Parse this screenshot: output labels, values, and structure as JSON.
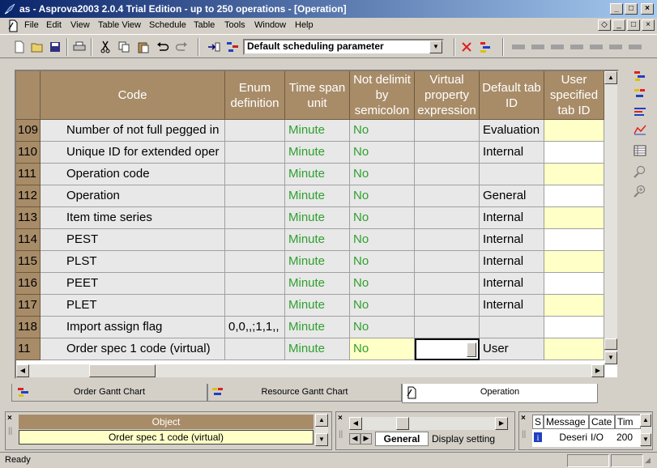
{
  "window": {
    "title": "as - Asprova2003 2.0.4 Trial Edition  - up to 250 operations - [Operation]"
  },
  "menu": [
    "File",
    "Edit",
    "View",
    "Table View",
    "Schedule",
    "Table",
    "Tools",
    "Window",
    "Help"
  ],
  "toolbar": {
    "schedule_param": "Default scheduling parameter"
  },
  "grid": {
    "columns": [
      "Code",
      "Enum definition",
      "Time span unit",
      "Not delimit by semicolon",
      "Virtual property expression",
      "Default tab ID",
      "User specified tab ID"
    ],
    "rows": [
      {
        "no": "109",
        "code": "Number of not full pegged in",
        "enum": "",
        "unit": "Minute",
        "nodelim": "No",
        "virtual": "",
        "tab": "Evaluation",
        "usertab": "",
        "usercolor": "yel"
      },
      {
        "no": "110",
        "code": "Unique ID for extended oper",
        "enum": "",
        "unit": "Minute",
        "nodelim": "No",
        "virtual": "",
        "tab": "Internal",
        "usertab": "",
        "usercolor": "wht"
      },
      {
        "no": "111",
        "code": "Operation code",
        "enum": "",
        "unit": "Minute",
        "nodelim": "No",
        "virtual": "",
        "tab": "",
        "usertab": "",
        "usercolor": "yel"
      },
      {
        "no": "112",
        "code": "Operation",
        "enum": "",
        "unit": "Minute",
        "nodelim": "No",
        "virtual": "",
        "tab": "General",
        "usertab": "",
        "usercolor": "wht"
      },
      {
        "no": "113",
        "code": "Item time series",
        "enum": "",
        "unit": "Minute",
        "nodelim": "No",
        "virtual": "",
        "tab": "Internal",
        "usertab": "",
        "usercolor": "yel"
      },
      {
        "no": "114",
        "code": "PEST",
        "enum": "",
        "unit": "Minute",
        "nodelim": "No",
        "virtual": "",
        "tab": "Internal",
        "usertab": "",
        "usercolor": "wht"
      },
      {
        "no": "115",
        "code": "PLST",
        "enum": "",
        "unit": "Minute",
        "nodelim": "No",
        "virtual": "",
        "tab": "Internal",
        "usertab": "",
        "usercolor": "yel"
      },
      {
        "no": "116",
        "code": "PEET",
        "enum": "",
        "unit": "Minute",
        "nodelim": "No",
        "virtual": "",
        "tab": "Internal",
        "usertab": "",
        "usercolor": "wht"
      },
      {
        "no": "117",
        "code": "PLET",
        "enum": "",
        "unit": "Minute",
        "nodelim": "No",
        "virtual": "",
        "tab": "Internal",
        "usertab": "",
        "usercolor": "yel"
      },
      {
        "no": "118",
        "code": "Import assign flag",
        "enum": "0,0,,;1,1,,",
        "unit": "Minute",
        "nodelim": "No",
        "virtual": "",
        "tab": "",
        "usertab": "",
        "usercolor": "wht"
      },
      {
        "no": "11",
        "code": "Order spec 1 code (virtual)",
        "enum": "",
        "unit": "Minute",
        "nodelim": "No",
        "virtual": "",
        "tab": "User",
        "usertab": "",
        "usercolor": "yel"
      }
    ]
  },
  "tabs": [
    "Order Gantt Chart",
    "Resource Gantt Chart",
    "Operation"
  ],
  "object_panel": {
    "header": "Object",
    "value": "Order spec 1 code (virtual)"
  },
  "property_tabs": [
    "General",
    "Display setting"
  ],
  "message_panel": {
    "columns": [
      "S",
      "Message",
      "Cate",
      "Tim"
    ],
    "row": {
      "message": "Deseri",
      "cate": "I/O",
      "time": "200"
    }
  },
  "status": {
    "text": "Ready"
  }
}
